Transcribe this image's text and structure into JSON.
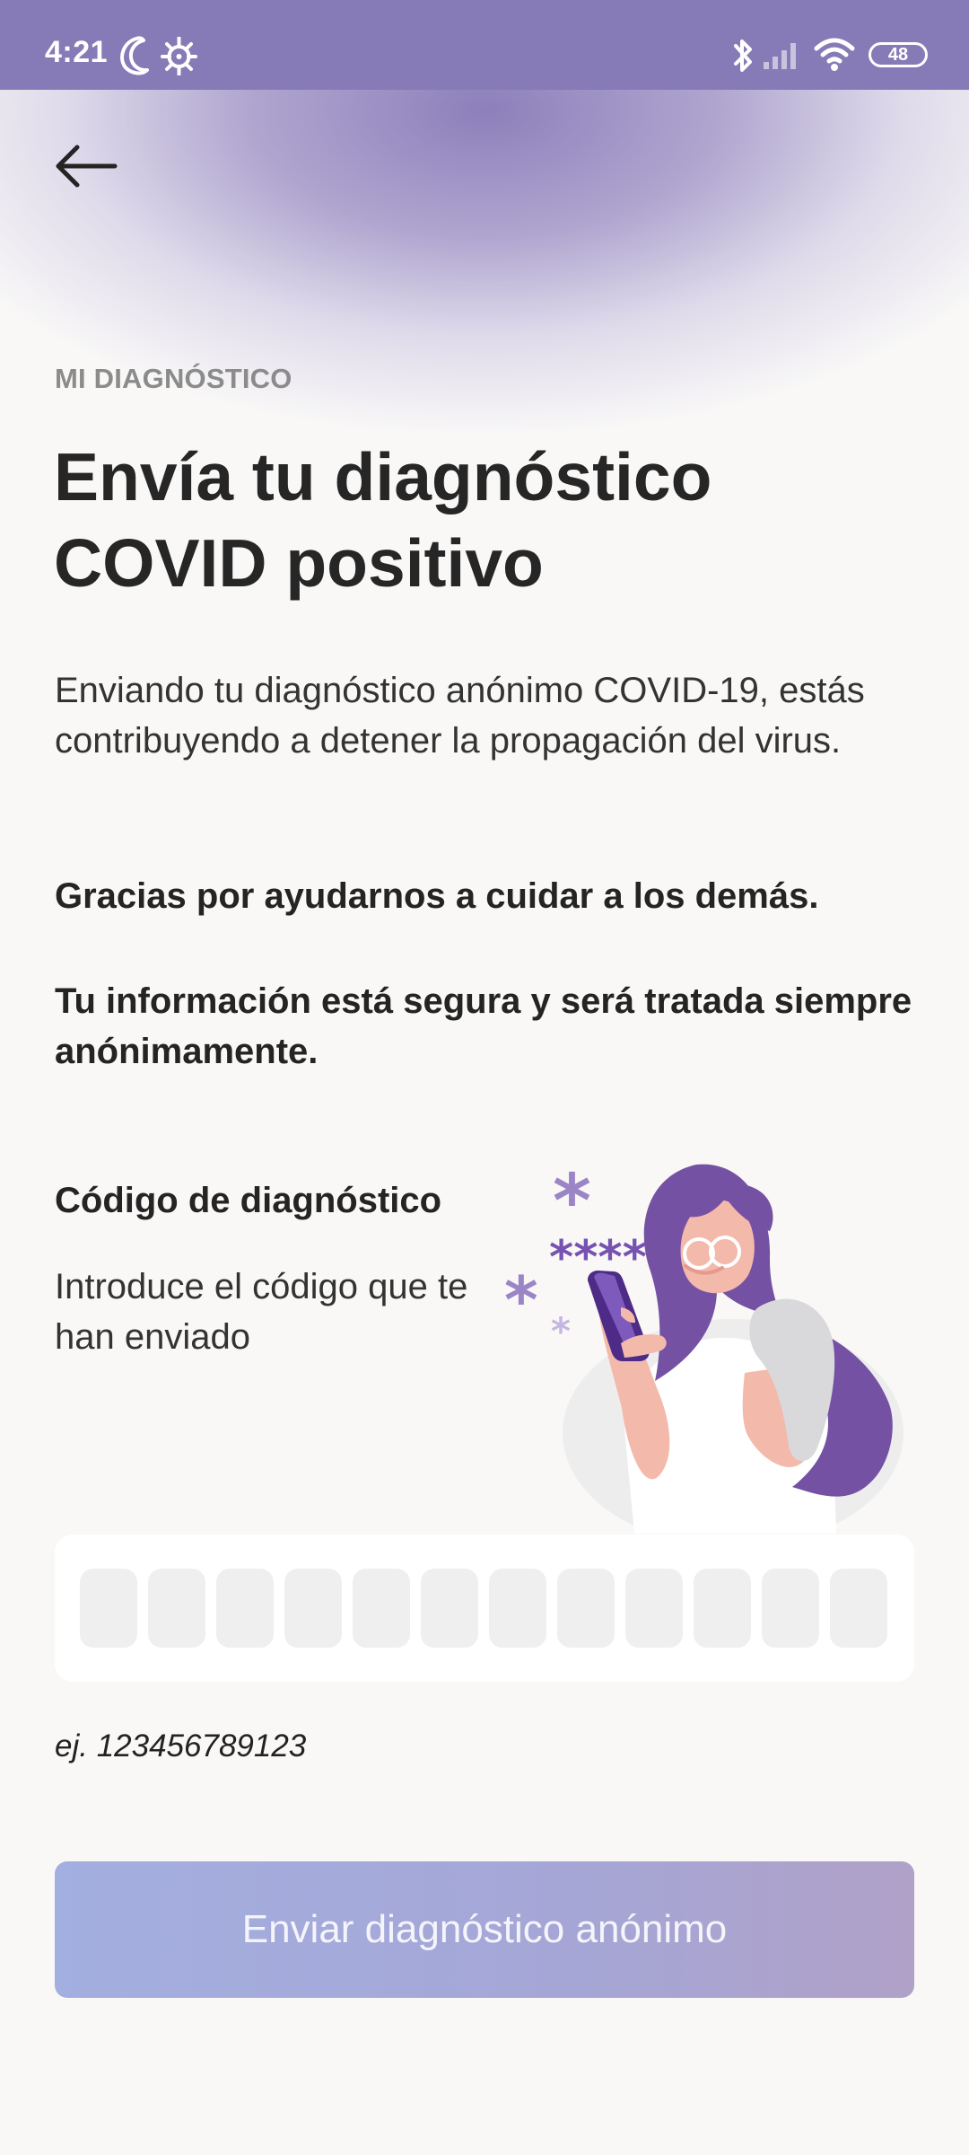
{
  "status_bar": {
    "time": "4:21",
    "battery": "48",
    "icons": [
      "moon-icon",
      "debug-icon",
      "bluetooth-icon",
      "signal-icon",
      "wifi-icon",
      "battery-icon"
    ]
  },
  "navigation": {
    "back_icon": "back-arrow-icon"
  },
  "content": {
    "eyebrow": "MI DIAGNÓSTICO",
    "title": "Envía tu diagnóstico COVID positivo",
    "intro": "Enviando tu diagnóstico anónimo COVID-19, estás contribuyendo a detener la propagación del virus.",
    "thanks": "Gracias por ayudarnos a cuidar a los demás.",
    "privacy": "Tu información está segura y será tratada siempre anónimamente."
  },
  "diagnostic_code": {
    "label": "Código de diagnóstico",
    "help": "Introduce el código que te han enviado",
    "example": "ej. 123456789123",
    "digits": [
      "",
      "",
      "",
      "",
      "",
      "",
      "",
      "",
      "",
      "",
      "",
      ""
    ],
    "illustration_text": "****"
  },
  "actions": {
    "submit_label": "Enviar diagnóstico anónimo"
  },
  "colors": {
    "accent_purple": "#867bb6",
    "text_primary": "#262626",
    "button_gradient_start": "#a3afe0",
    "button_gradient_end": "#b0a1c8",
    "page_background": "#f9f8f7"
  }
}
